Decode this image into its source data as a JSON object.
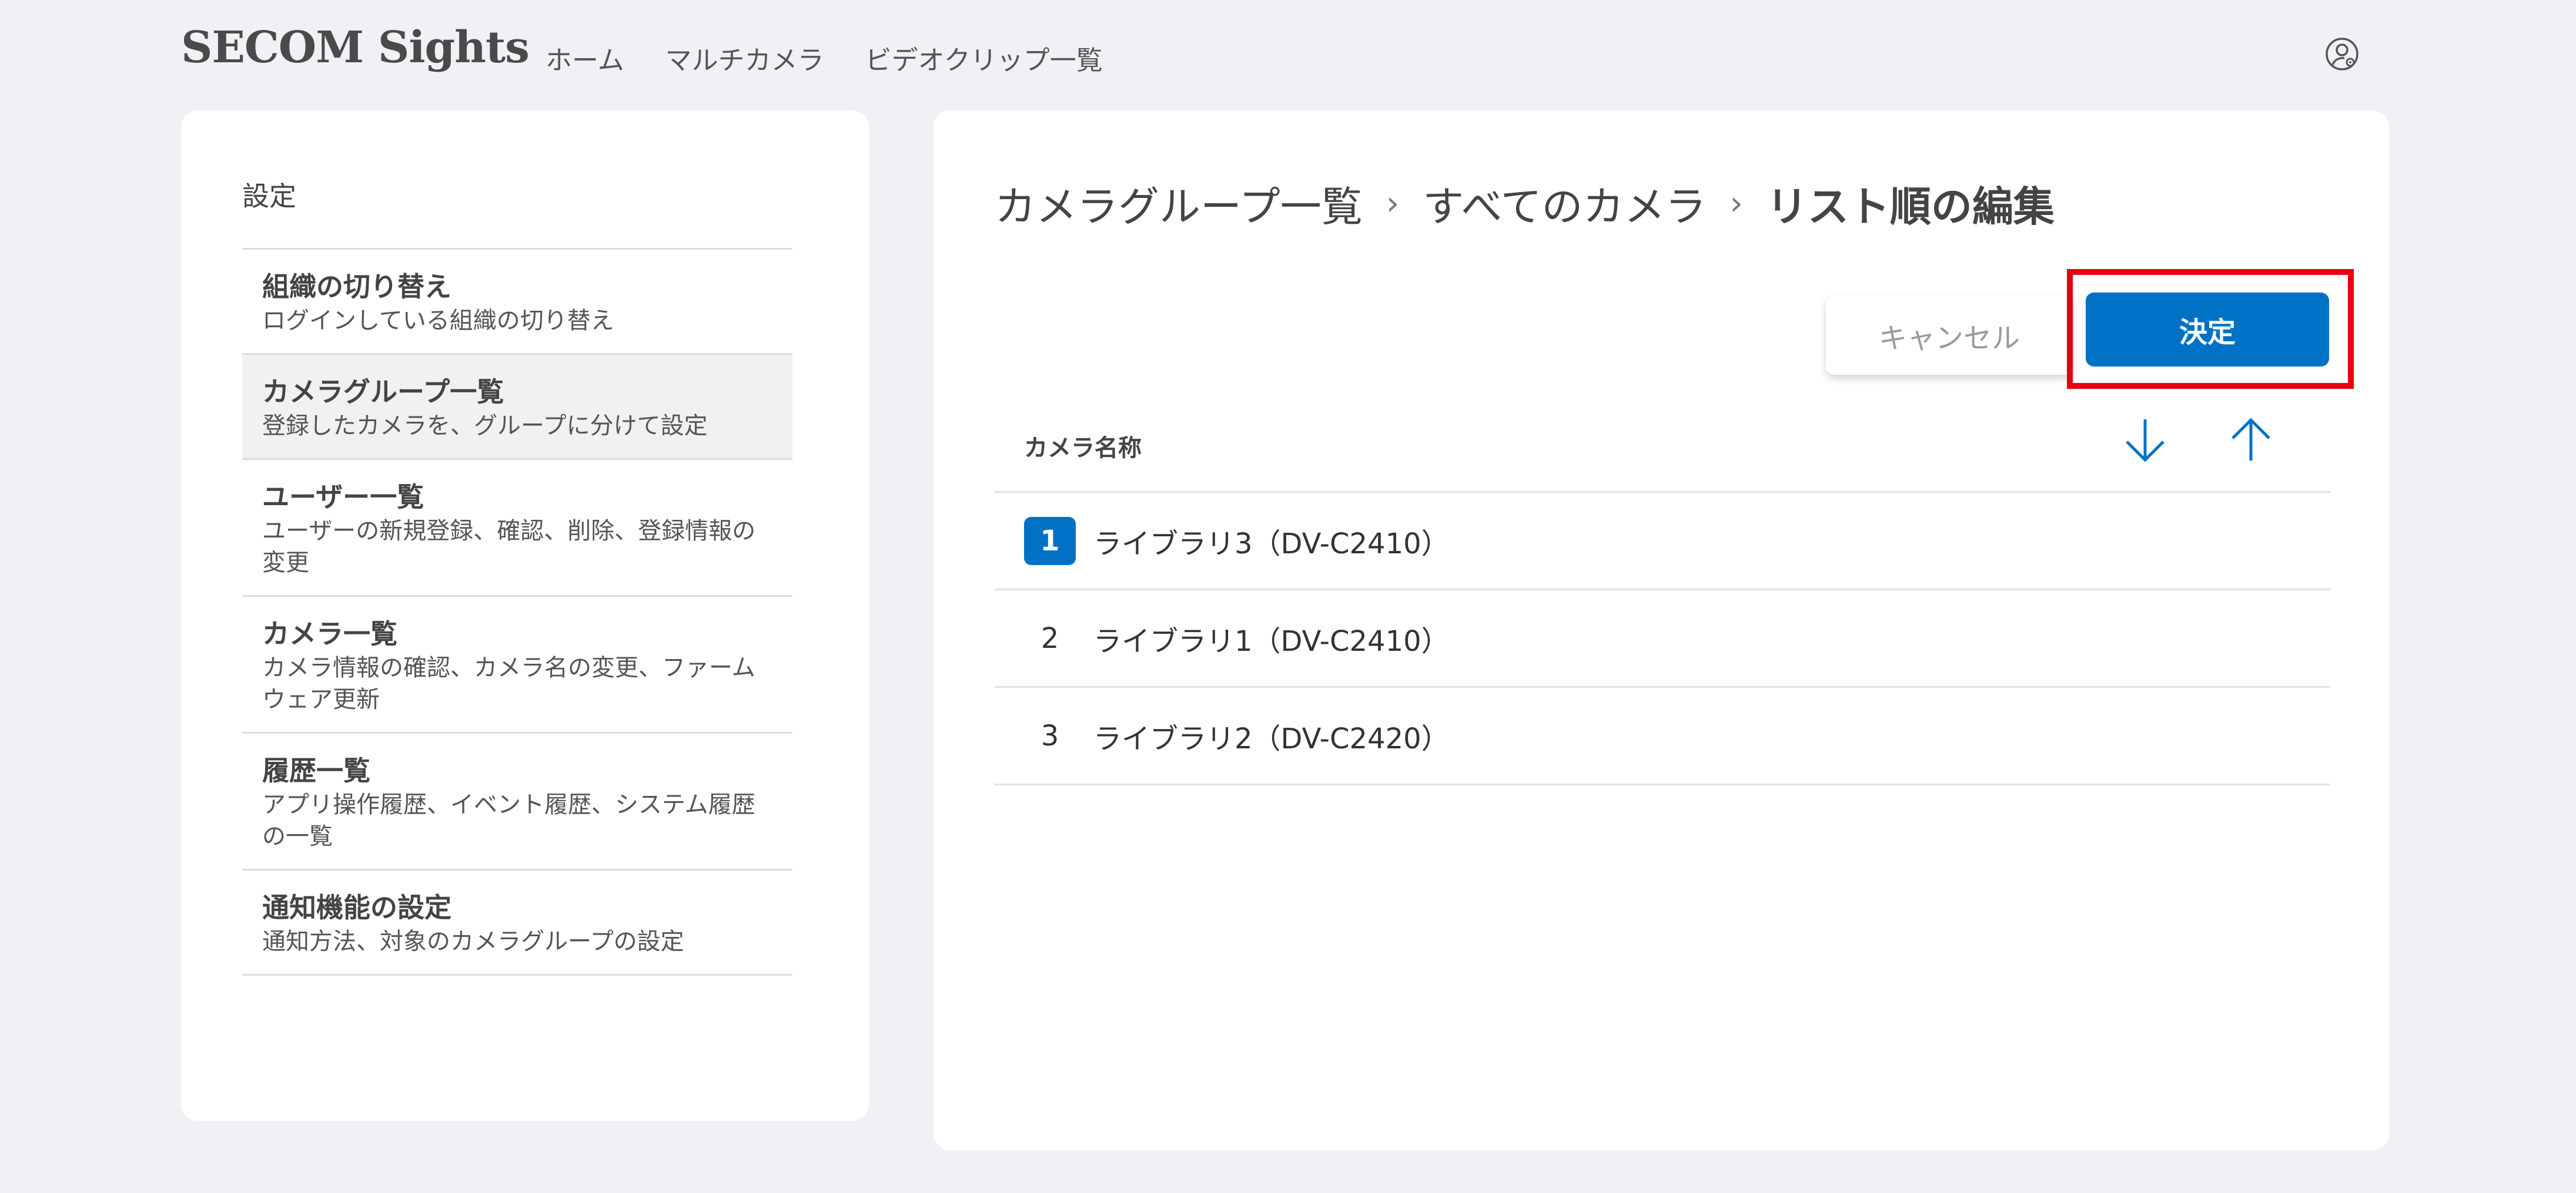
{
  "header": {
    "logo": "SECOM Sights",
    "nav": [
      "ホーム",
      "マルチカメラ",
      "ビデオクリップ一覧"
    ],
    "user_icon": "user-settings-icon"
  },
  "sidebar": {
    "title": "設定",
    "items": [
      {
        "title": "組織の切り替え",
        "desc": "ログインしている組織の切り替え",
        "active": false
      },
      {
        "title": "カメラグループ一覧",
        "desc": "登録したカメラを、グループに分けて設定",
        "active": true
      },
      {
        "title": "ユーザー一覧",
        "desc": "ユーザーの新規登録、確認、削除、登録情報の変更",
        "active": false
      },
      {
        "title": "カメラ一覧",
        "desc": "カメラ情報の確認、カメラ名の変更、ファームウェア更新",
        "active": false
      },
      {
        "title": "履歴一覧",
        "desc": "アプリ操作履歴、イベント履歴、システム履歴の一覧",
        "active": false
      },
      {
        "title": "通知機能の設定",
        "desc": "通知方法、対象のカメラグループの設定",
        "active": false
      }
    ]
  },
  "main": {
    "breadcrumb": [
      "カメラグループ一覧",
      "すべてのカメラ",
      "リスト順の編集"
    ],
    "breadcrumb_separator": "›",
    "cancel_label": "キャンセル",
    "confirm_label": "決定",
    "column_header": "カメラ名称",
    "sort_icons": [
      "arrow-down-icon",
      "arrow-up-icon"
    ],
    "rows": [
      {
        "num": "1",
        "name": "ライブラリ3（DV-C2410）",
        "selected": true
      },
      {
        "num": "2",
        "name": "ライブラリ1（DV-C2410）",
        "selected": false
      },
      {
        "num": "3",
        "name": "ライブラリ2（DV-C2420）",
        "selected": false
      }
    ]
  },
  "colors": {
    "accent": "#0071c5",
    "highlight": "#e60012",
    "background": "#f0f1f5"
  }
}
